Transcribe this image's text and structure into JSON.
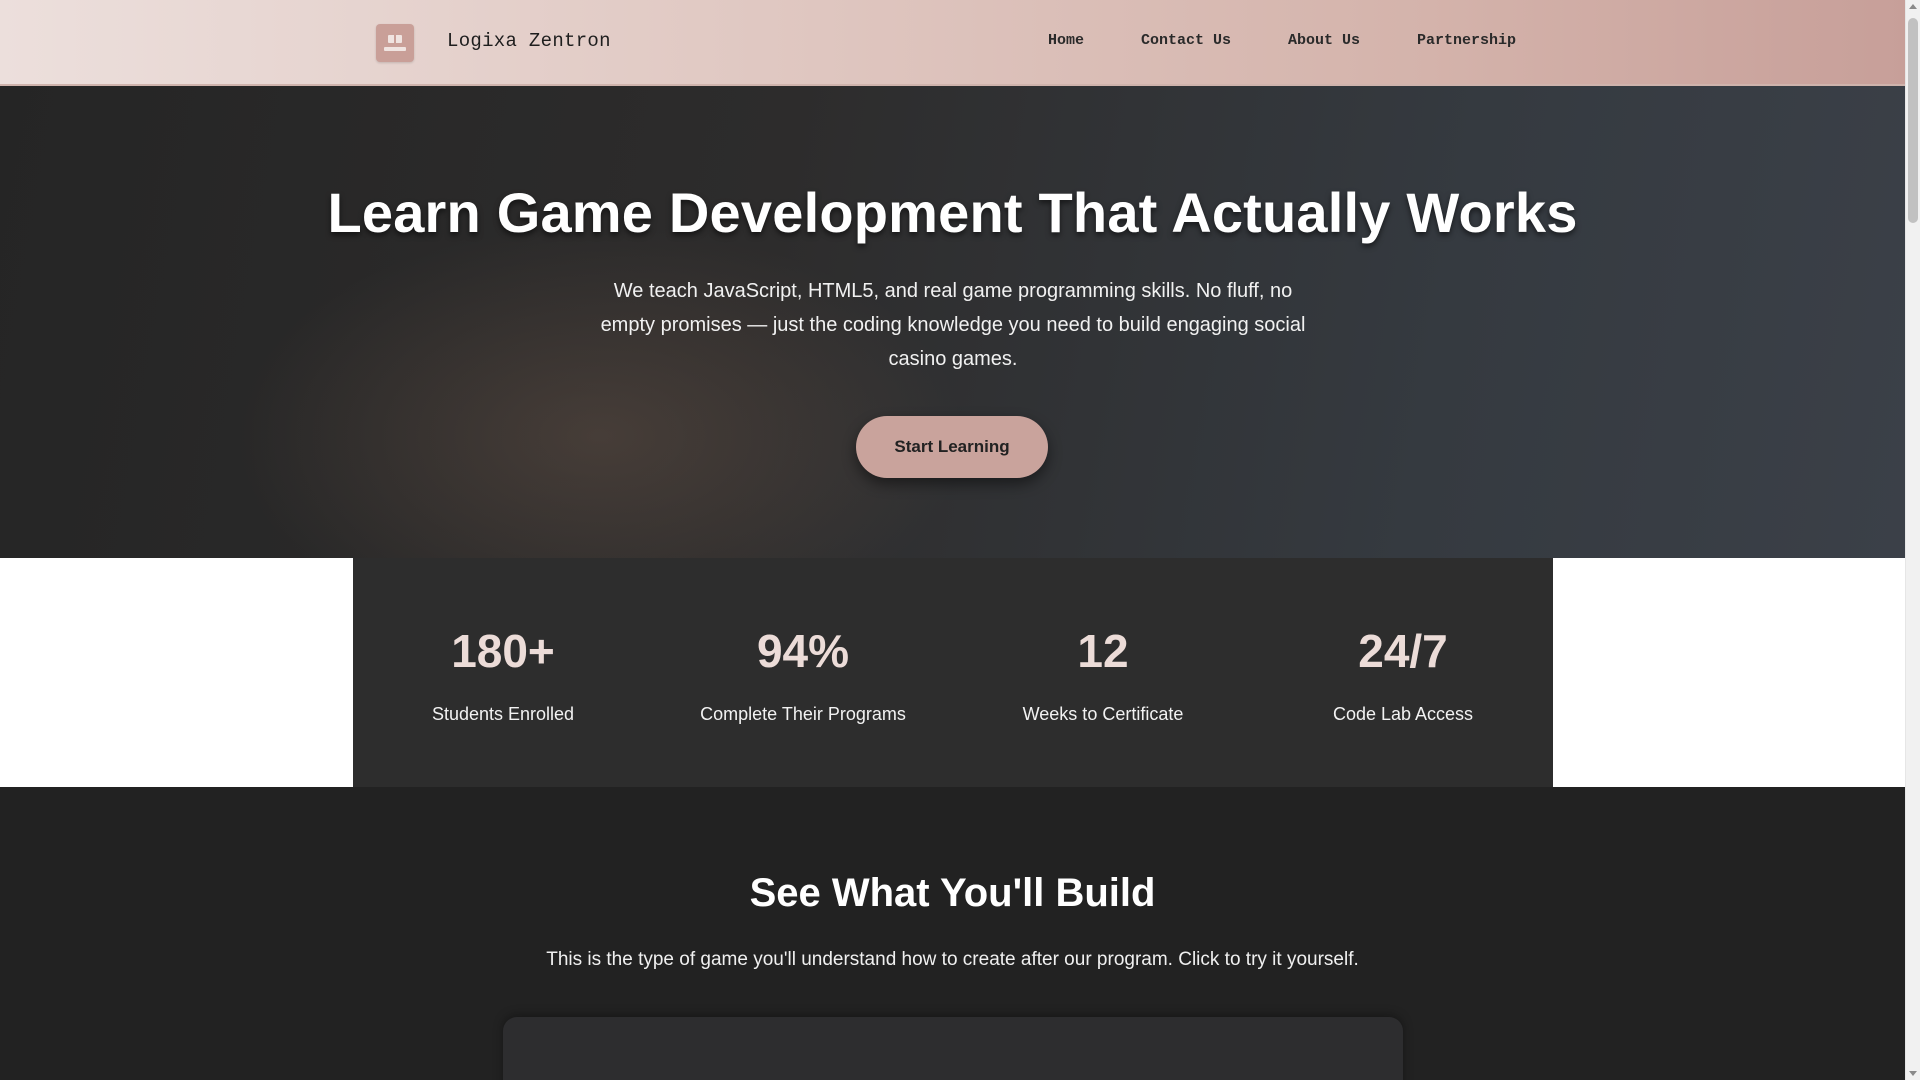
{
  "header": {
    "brand_name": "Logixa Zentron",
    "logo_icon": "logo-icon",
    "nav": {
      "home": "Home",
      "contact": "Contact Us",
      "about": "About Us",
      "partnership": "Partnership"
    }
  },
  "hero": {
    "title": "Learn Game Development That Actually Works",
    "subtitle": "We teach JavaScript, HTML5, and real game programming skills. No fluff, no empty promises — just the coding knowledge you need to build engaging social casino games.",
    "cta_label": "Start Learning"
  },
  "stats": [
    {
      "value": "180+",
      "label": "Students Enrolled"
    },
    {
      "value": "94%",
      "label": "Complete Their Programs"
    },
    {
      "value": "12",
      "label": "Weeks to Certificate"
    },
    {
      "value": "24/7",
      "label": "Code Lab Access"
    }
  ],
  "build": {
    "title": "See What You'll Build",
    "subtitle": "This is the type of game you'll understand how to create after our program. Click to try it yourself."
  },
  "colors": {
    "accent": "#c9a39c",
    "stat_value": "#ecdcd8",
    "dark_bg": "#222222",
    "stats_panel": "#2d2d2d"
  }
}
